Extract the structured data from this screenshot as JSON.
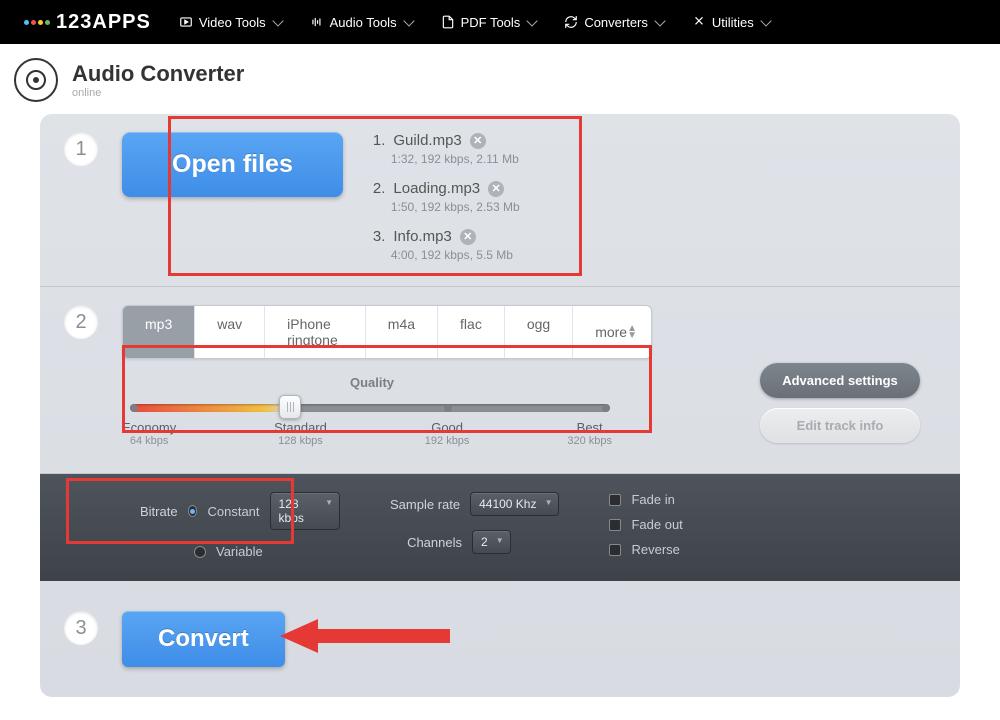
{
  "nav": {
    "logo": "123APPS",
    "items": [
      "Video Tools",
      "Audio Tools",
      "PDF Tools",
      "Converters",
      "Utilities"
    ]
  },
  "header": {
    "title": "Audio Converter",
    "sub": "online"
  },
  "step1": {
    "open_label": "Open files",
    "files": [
      {
        "idx": "1.",
        "name": "Guild.mp3",
        "meta": "1:32, 192 kbps, 2.11 Mb"
      },
      {
        "idx": "2.",
        "name": "Loading.mp3",
        "meta": "1:50, 192 kbps, 2.53 Mb"
      },
      {
        "idx": "3.",
        "name": "Info.mp3",
        "meta": "4:00, 192 kbps, 5.5 Mb"
      }
    ]
  },
  "step2": {
    "formats": [
      "mp3",
      "wav",
      "iPhone ringtone",
      "m4a",
      "flac",
      "ogg",
      "more"
    ],
    "quality_label": "Quality",
    "ticks": [
      {
        "label": "Economy",
        "sub": "64 kbps"
      },
      {
        "label": "Standard",
        "sub": "128 kbps"
      },
      {
        "label": "Good",
        "sub": "192 kbps"
      },
      {
        "label": "Best",
        "sub": "320 kbps"
      }
    ],
    "advanced_btn": "Advanced settings",
    "edit_btn": "Edit track info"
  },
  "adv": {
    "bitrate_label": "Bitrate",
    "constant": "Constant",
    "variable": "Variable",
    "bitrate_value": "128 kbps",
    "samplerate_label": "Sample rate",
    "samplerate_value": "44100 Khz",
    "channels_label": "Channels",
    "channels_value": "2",
    "fadein": "Fade in",
    "fadeout": "Fade out",
    "reverse": "Reverse"
  },
  "step3": {
    "convert_label": "Convert"
  }
}
